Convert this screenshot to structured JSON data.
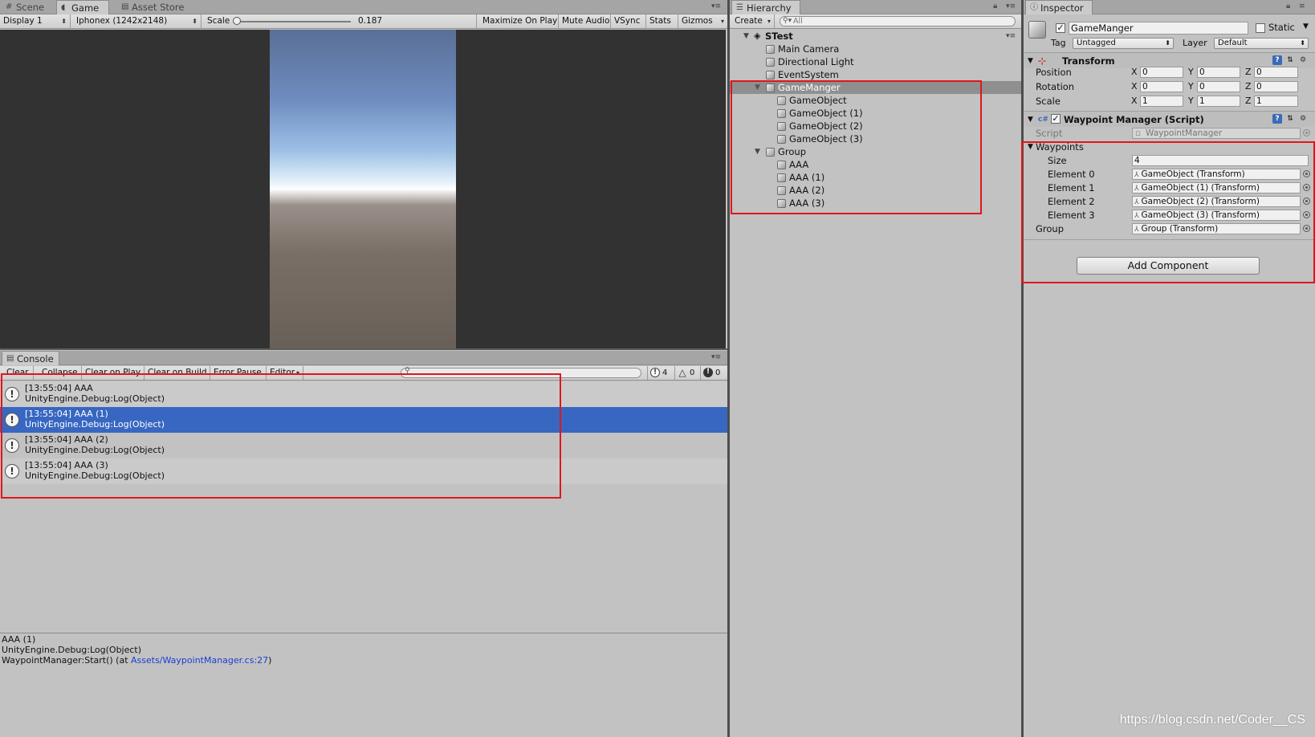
{
  "scene_tabs": {
    "scene": "Scene",
    "game": "Game",
    "asset_store": "Asset Store"
  },
  "game_toolbar": {
    "display": "Display 1",
    "resolution": "Iphonex (1242x2148)",
    "scale_label": "Scale",
    "scale_value": "0.187",
    "scale_fraction": 0.0,
    "maximize": "Maximize On Play",
    "mute": "Mute Audio",
    "vsync": "VSync",
    "stats": "Stats",
    "gizmos": "Gizmos"
  },
  "console": {
    "tab": "Console",
    "toolbar": {
      "clear": "Clear",
      "collapse": "Collapse",
      "clear_on_play": "Clear on Play",
      "clear_on_build": "Clear on Build",
      "error_pause": "Error Pause",
      "editor": "Editor"
    },
    "counts": {
      "info": "4",
      "warn": "0",
      "error": "0"
    },
    "entries": [
      {
        "line1": "[13:55:04] AAA",
        "line2": "UnityEngine.Debug:Log(Object)"
      },
      {
        "line1": "[13:55:04] AAA (1)",
        "line2": "UnityEngine.Debug:Log(Object)"
      },
      {
        "line1": "[13:55:04] AAA (2)",
        "line2": "UnityEngine.Debug:Log(Object)"
      },
      {
        "line1": "[13:55:04] AAA (3)",
        "line2": "UnityEngine.Debug:Log(Object)"
      }
    ],
    "detail": {
      "line1": "AAA (1)",
      "line2": "UnityEngine.Debug:Log(Object)",
      "line3_prefix": "WaypointManager:Start() (at ",
      "line3_link": "Assets/WaypointManager.cs:27",
      "line3_suffix": ")"
    }
  },
  "hierarchy": {
    "tab": "Hierarchy",
    "create": "Create",
    "search_placeholder": "All",
    "scene_name": "STest",
    "items": [
      "Main Camera",
      "Directional Light",
      "EventSystem",
      "GameManger",
      "GameObject",
      "GameObject (1)",
      "GameObject (2)",
      "GameObject (3)",
      "Group",
      "AAA",
      "AAA (1)",
      "AAA (2)",
      "AAA (3)"
    ]
  },
  "inspector": {
    "tab": "Inspector",
    "object_name": "GameManger",
    "static_label": "Static",
    "tag_label": "Tag",
    "tag_value": "Untagged",
    "layer_label": "Layer",
    "layer_value": "Default",
    "transform": {
      "title": "Transform",
      "position_label": "Position",
      "rotation_label": "Rotation",
      "scale_label": "Scale",
      "axes": {
        "x": "X",
        "y": "Y",
        "z": "Z"
      },
      "position": [
        "0",
        "0",
        "0"
      ],
      "rotation": [
        "0",
        "0",
        "0"
      ],
      "scale": [
        "1",
        "1",
        "1"
      ]
    },
    "script_component": {
      "title": "Waypoint Manager (Script)",
      "script_label": "Script",
      "script_value": "WaypointManager",
      "waypoints_label": "Waypoints",
      "size_label": "Size",
      "size_value": "4",
      "elements": [
        {
          "label": "Element 0",
          "value": "GameObject (Transform)"
        },
        {
          "label": "Element 1",
          "value": "GameObject (1) (Transform)"
        },
        {
          "label": "Element 2",
          "value": "GameObject (2) (Transform)"
        },
        {
          "label": "Element 3",
          "value": "GameObject (3) (Transform)"
        }
      ],
      "group_label": "Group",
      "group_value": "Group (Transform)"
    },
    "add_component": "Add Component"
  },
  "watermark": "https://blog.csdn.net/Coder__CS",
  "colors": {
    "selection_blue": "#3867c2",
    "highlight_red": "#e0161b",
    "link_blue": "#1a3ed4"
  }
}
